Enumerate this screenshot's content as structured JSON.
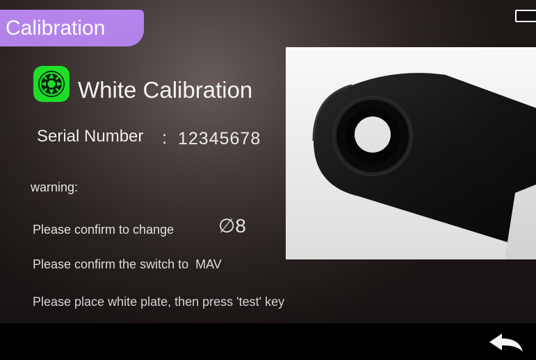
{
  "header": {
    "title": "Calibration"
  },
  "main": {
    "heading": "White Calibration",
    "heading_icon": "white-calibration-icon",
    "serial_label": "Serial Number",
    "serial_colon": ":",
    "serial_value": "12345678",
    "warning_label": "warning:",
    "confirm_aperture_text": "Please confirm to change",
    "aperture_value": "∅8",
    "confirm_switch_text": "Please confirm the switch to",
    "switch_value": "MAV",
    "instruction_text": "Please place white plate, then press 'test' key"
  },
  "footer": {
    "back_icon": "back-arrow-icon"
  },
  "colors": {
    "title_tab": "#b685ee",
    "icon_green": "#1ee82a",
    "background": "#3a302e",
    "text": "#ffffff"
  }
}
